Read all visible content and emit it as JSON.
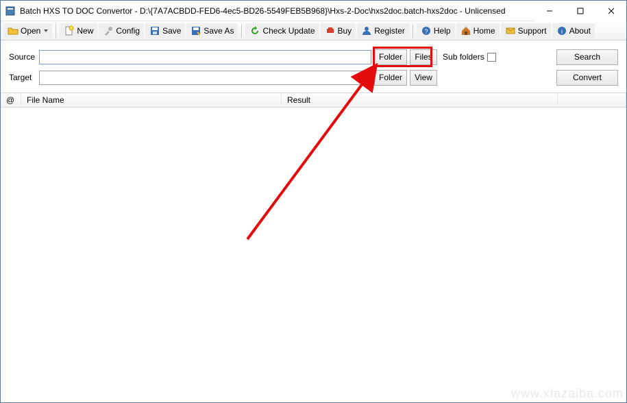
{
  "window": {
    "title": "Batch HXS TO DOC Convertor - D:\\{7A7ACBDD-FED6-4ec5-BD26-5549FEB5B968}\\Hxs-2-Doc\\hxs2doc.batch-hxs2doc - Unlicensed"
  },
  "toolbar": {
    "open": "Open",
    "new": "New",
    "config": "Config",
    "save": "Save",
    "save_as": "Save As",
    "check_update": "Check Update",
    "buy": "Buy",
    "register": "Register",
    "help": "Help",
    "home": "Home",
    "support": "Support",
    "about": "About"
  },
  "form": {
    "source_label": "Source",
    "source_value": "",
    "source_folder_btn": "Folder",
    "source_files_btn": "Files",
    "sub_folders_label": "Sub folders",
    "search_btn": "Search",
    "target_label": "Target",
    "target_value": "",
    "target_folder_btn": "Folder",
    "target_view_btn": "View",
    "convert_btn": "Convert"
  },
  "list": {
    "col_at": "@",
    "col_filename": "File Name",
    "col_result": "Result",
    "rows": []
  },
  "watermark": "www.xiazaiba.com"
}
